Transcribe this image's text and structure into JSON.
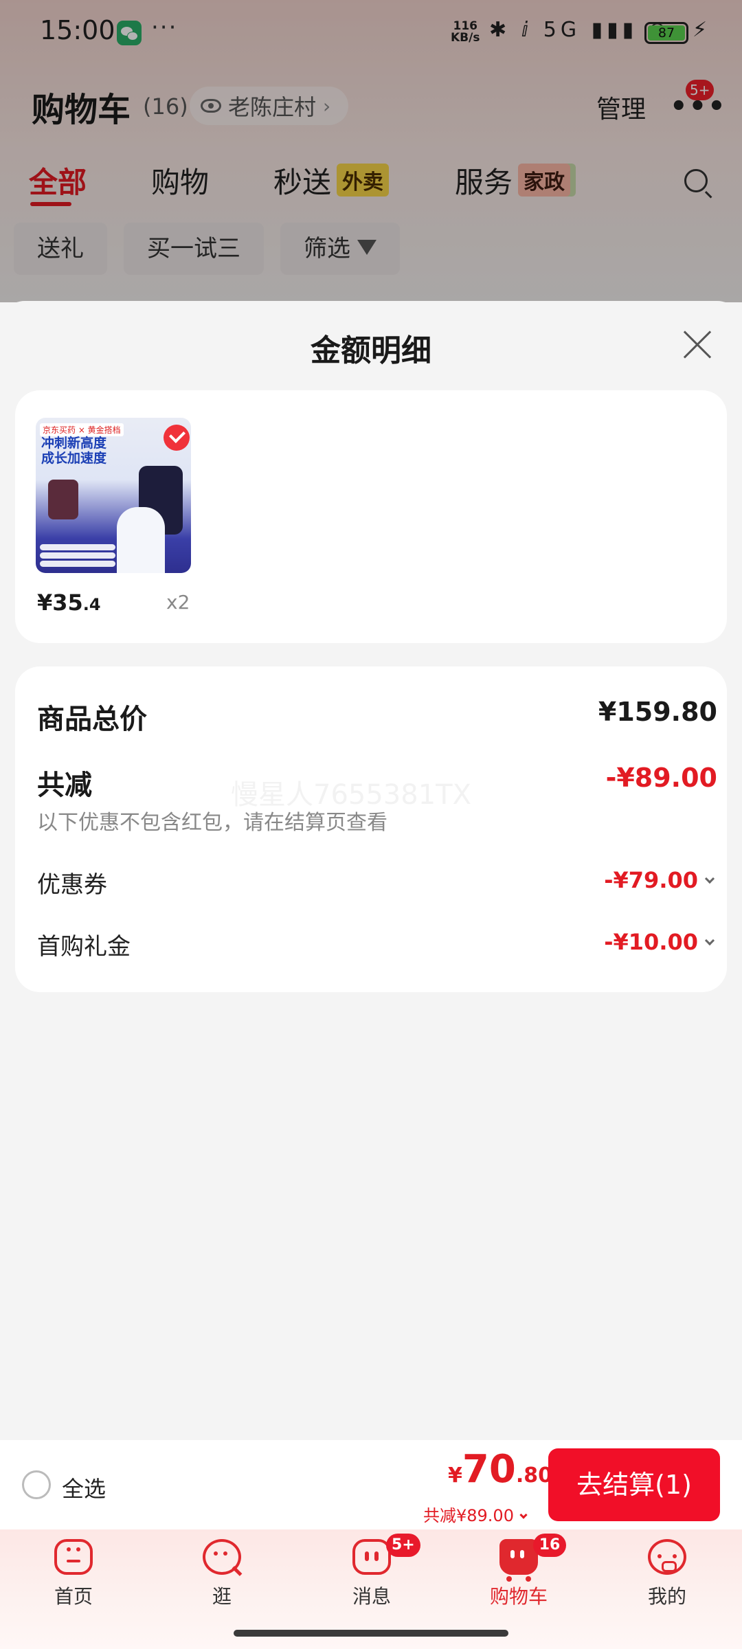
{
  "status_bar": {
    "time": "15:00",
    "dots": "···",
    "net_speed": "116\nKB/s",
    "icons": "✱ ⅈ 5G ▮▮▮ ◠",
    "battery": "87",
    "charging": "⚡"
  },
  "header": {
    "title": "购物车",
    "count": "(16)",
    "location": "老陈庄村",
    "manage_label": "管理",
    "more_badge": "5+"
  },
  "tabs": [
    {
      "label": "全部"
    },
    {
      "label": "购物"
    },
    {
      "label": "秒送",
      "tag": "外卖"
    },
    {
      "label": "服务",
      "tag": "家政"
    }
  ],
  "chips": [
    {
      "label": "送礼"
    },
    {
      "label": "买一试三"
    },
    {
      "label": "筛选"
    }
  ],
  "sheet": {
    "title": "金额明细",
    "item": {
      "image_brand": "京东买药 × 黄金搭档",
      "image_headline": "冲刺新高度\n成长加速度",
      "price_main": "¥35",
      "price_decimal": ".4",
      "quantity": "x2"
    },
    "summary": {
      "total_label": "商品总价",
      "total_value": "¥159.80",
      "reduce_label": "共减",
      "reduce_value": "-¥89.00",
      "reduce_note": "以下优惠不包含红包，请在结算页查看",
      "rows": [
        {
          "label": "优惠券",
          "value": "-¥79.00"
        },
        {
          "label": "首购礼金",
          "value": "-¥10.00"
        }
      ]
    },
    "watermark": "慢星人7655381TX"
  },
  "checkout": {
    "select_all_label": "全选",
    "total_yen": "¥",
    "total_int": "70",
    "total_dec": ".80",
    "saving": "共减¥89.00",
    "button_label": "去结算(1)"
  },
  "tab_bar": [
    {
      "label": "首页",
      "icon": "home-icon"
    },
    {
      "label": "逛",
      "icon": "browse-icon"
    },
    {
      "label": "消息",
      "icon": "message-icon",
      "badge": "5+"
    },
    {
      "label": "购物车",
      "icon": "cart-icon",
      "badge": "16",
      "active": true
    },
    {
      "label": "我的",
      "icon": "profile-icon"
    }
  ],
  "colors": {
    "accent": "#e21b23",
    "checkout_button": "#f10f28",
    "background": "#f4f4f4"
  }
}
